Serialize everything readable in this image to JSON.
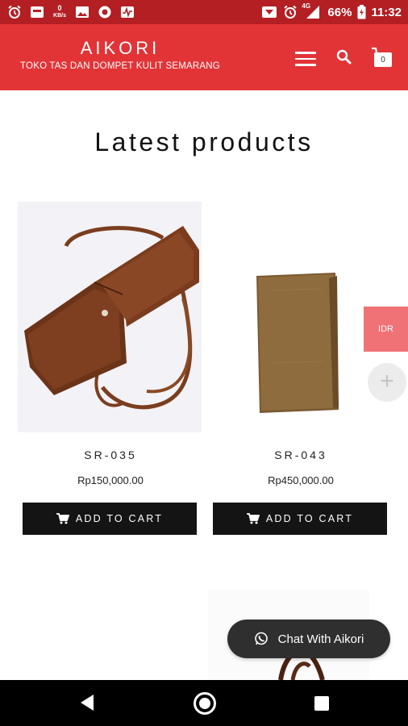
{
  "status_bar": {
    "netspeed_value": "0",
    "netspeed_unit": "KB/s",
    "network_label": "4G",
    "battery": "66%",
    "time": "11:32"
  },
  "header": {
    "brand_title": "AIKORI",
    "brand_tagline": "TOKO TAS DAN DOMPET KULIT SEMARANG",
    "cart_count": "0"
  },
  "main": {
    "section_title": "Latest products",
    "products": [
      {
        "name": "SR-035",
        "price": "Rp150,000.00",
        "button_label": "ADD TO CART"
      },
      {
        "name": "SR-043",
        "price": "Rp450,000.00",
        "button_label": "ADD TO CART"
      }
    ]
  },
  "widgets": {
    "currency": "IDR",
    "plus": "+",
    "chat_label": "Chat With Aikori"
  },
  "colors": {
    "status_bar": "#b31f23",
    "header": "#e23437",
    "currency_tab": "#f07276",
    "button": "#141414"
  }
}
